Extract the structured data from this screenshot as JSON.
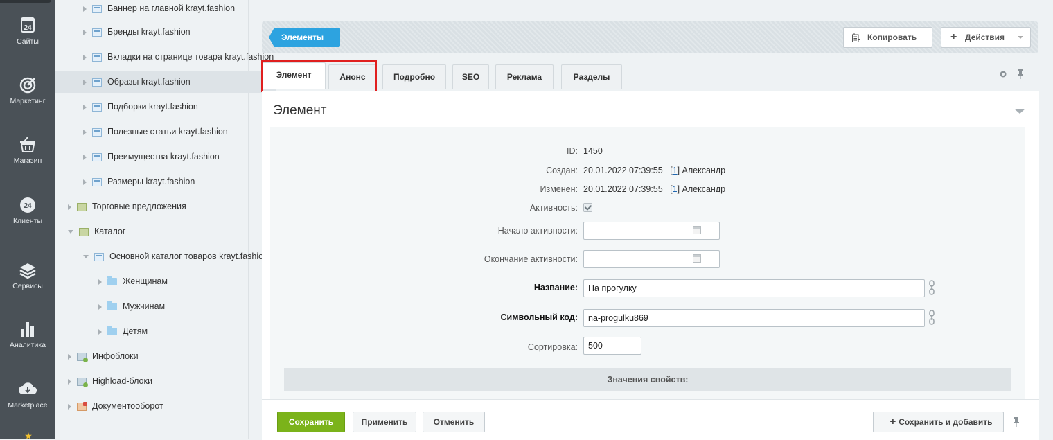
{
  "leftbar": {
    "items": [
      {
        "label": "Сайты",
        "icon": "calendar-24-icon"
      },
      {
        "label": "Маркетинг",
        "icon": "target-icon"
      },
      {
        "label": "Магазин",
        "icon": "basket-icon"
      },
      {
        "label": "Клиенты",
        "icon": "bitrix24-clients-icon"
      },
      {
        "label": "Сервисы",
        "icon": "layers-icon"
      },
      {
        "label": "Аналитика",
        "icon": "bar-chart-icon"
      },
      {
        "label": "Marketplace",
        "icon": "cloud-download-icon"
      }
    ]
  },
  "tree": {
    "items": [
      {
        "label": "Баннер на главной krayt.fashion"
      },
      {
        "label": "Бренды krayt.fashion"
      },
      {
        "label": "Вкладки на странице товара krayt.fashion"
      },
      {
        "label": "Образы krayt.fashion"
      },
      {
        "label": "Подборки krayt.fashion"
      },
      {
        "label": "Полезные статьи krayt.fashion"
      },
      {
        "label": "Преимущества krayt.fashion"
      },
      {
        "label": "Размеры krayt.fashion"
      },
      {
        "label": "Торговые предложения"
      },
      {
        "label": "Каталог"
      },
      {
        "label": "Основной каталог товаров krayt.fashion"
      },
      {
        "label": "Женщинам"
      },
      {
        "label": "Мужчинам"
      },
      {
        "label": "Детям"
      },
      {
        "label": "Инфоблоки"
      },
      {
        "label": "Highload-блоки"
      },
      {
        "label": "Документооборот"
      }
    ]
  },
  "toolbar": {
    "elements_label": "Элементы",
    "copy_label": "Копировать",
    "actions_label": "Действия"
  },
  "tabs": [
    "Элемент",
    "Анонс",
    "Подробно",
    "SEO",
    "Реклама",
    "Разделы"
  ],
  "panel": {
    "title": "Элемент"
  },
  "form": {
    "id_label": "ID:",
    "id_value": "1450",
    "created_label": "Создан:",
    "created_value": "20.01.2022 07:39:55",
    "created_user_link": "1",
    "created_user_name": "Александр",
    "modified_label": "Изменен:",
    "modified_value": "20.01.2022 07:39:55",
    "modified_user_link": "1",
    "modified_user_name": "Александр",
    "active_label": "Активность:",
    "active_checked": true,
    "active_from_label": "Начало активности:",
    "active_from_value": "",
    "active_to_label": "Окончание активности:",
    "active_to_value": "",
    "name_label": "Название:",
    "name_value": "На прогулку",
    "code_label": "Символьный код:",
    "code_value": "na-progulku869",
    "sort_label": "Сортировка:",
    "sort_value": "500",
    "props_header": "Значения свойств:"
  },
  "bottom": {
    "save": "Сохранить",
    "apply": "Применить",
    "cancel": "Отменить",
    "save_add": "Сохранить и добавить"
  }
}
